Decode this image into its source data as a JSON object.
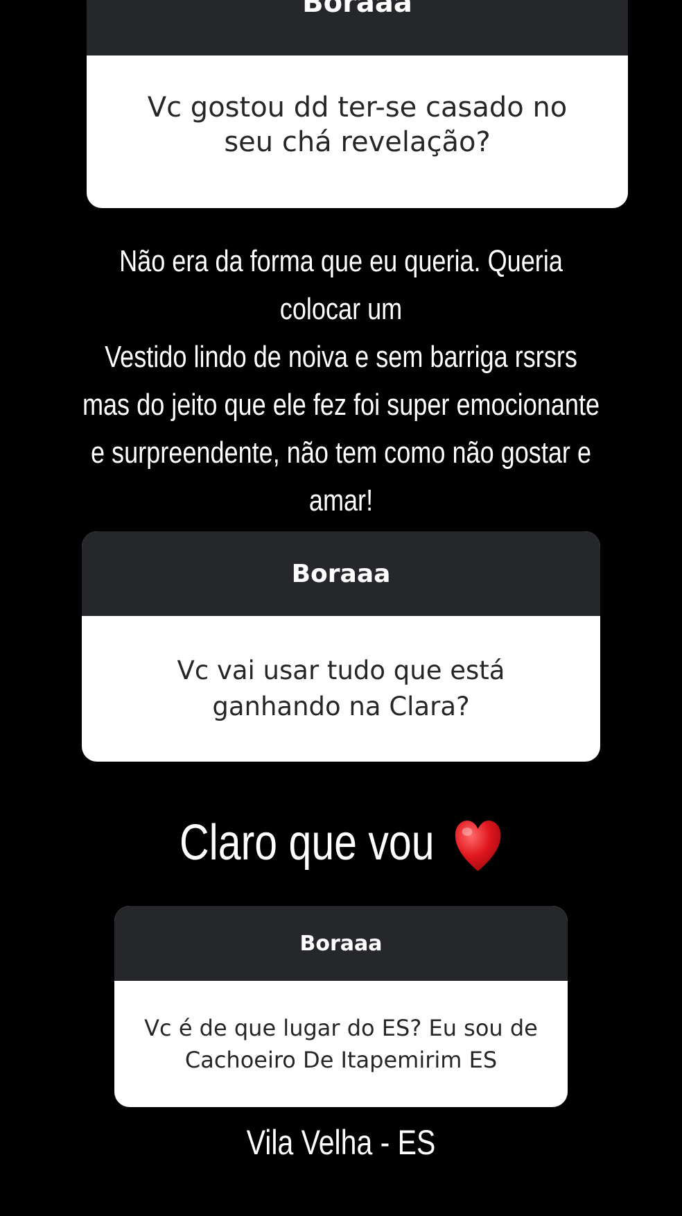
{
  "colors": {
    "background": "#000000",
    "box_header": "#25272b",
    "box_body": "#ffffff",
    "question_text": "#262626",
    "answer_text": "#ffffff",
    "heart": "#e0161e"
  },
  "story": {
    "card1": {
      "header": "Boraaa",
      "question": "Vc gostou dd ter-se casado no seu chá  revelação?"
    },
    "answer1": {
      "lines": [
        "Não era da forma que eu queria. Queria",
        "colocar um",
        "Vestido lindo de noiva e sem barriga rsrsrs",
        "mas do jeito que ele fez foi super emocionante",
        "e surpreendente, não tem como não gostar e",
        "amar!"
      ]
    },
    "card2": {
      "header": "Boraaa",
      "question": "Vc vai usar tudo que está ganhando na Clara?"
    },
    "answer2": {
      "text": "Claro que vou",
      "icon": "red-heart-icon"
    },
    "card3": {
      "header": "Boraaa",
      "question": "Vc é de que lugar do ES? Eu sou de Cachoeiro De Itapemirim ES"
    },
    "answer3": {
      "text": "Vila Velha - ES"
    }
  }
}
